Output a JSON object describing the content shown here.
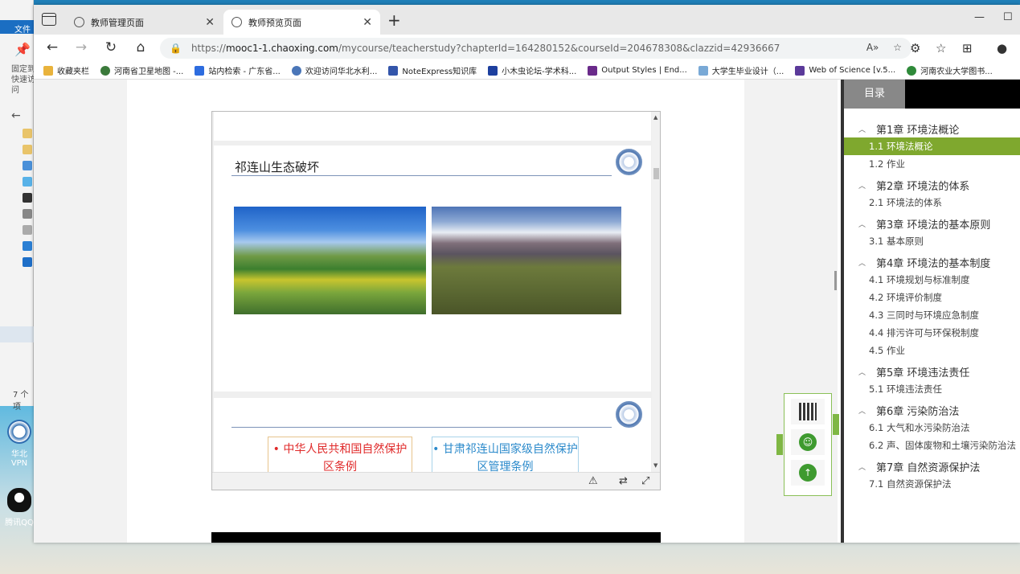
{
  "desktop": {
    "explorer_menu": "文件",
    "pin_label": "固定到快速访问",
    "item_count": "7 个项",
    "icons": [
      {
        "label": "华北VPN",
        "icon": "vpn-icon"
      },
      {
        "label": "腾讯QQ",
        "icon": "qq-penguin-icon"
      }
    ]
  },
  "browser": {
    "tabs": [
      {
        "label": "教师管理页面",
        "active": false
      },
      {
        "label": "教师预览页面",
        "active": true
      }
    ],
    "url_prefix": "https://",
    "url_host": "mooc1-1.chaoxing.com",
    "url_path": "/mycourse/teacherstudy?chapterId=164280152&courseId=204678308&clazzid=42936667",
    "favorites": [
      {
        "label": "收藏夹栏",
        "color": "#e9b33c"
      },
      {
        "label": "河南省卫星地图 -...",
        "color": "#3b7a3b"
      },
      {
        "label": "站内检索 - 广东省...",
        "color": "#2d6cdf"
      },
      {
        "label": "欢迎访问华北水利...",
        "color": "#4a76b8"
      },
      {
        "label": "NoteExpress知识库",
        "color": "#3355aa"
      },
      {
        "label": "小木虫论坛-学术科...",
        "color": "#1d3f9e"
      },
      {
        "label": "Output Styles | End...",
        "color": "#6a2a8a"
      },
      {
        "label": "大学生毕业设计（...",
        "color": "#79a9d6"
      },
      {
        "label": "Web of Science [v.5...",
        "color": "#5b3a9a"
      },
      {
        "label": "河南农业大学图书...",
        "color": "#2f8a3a"
      }
    ]
  },
  "viewer": {
    "slide1_title": "祁连山生态破坏",
    "laws": [
      "• 中华人民共和国自然保护区条例",
      "• 甘肃祁连山国家级自然保护区管理条例"
    ]
  },
  "toc": {
    "tab_label": "目录",
    "chapters": [
      {
        "title": "第1章 环境法概论",
        "sections": [
          "1.1 环境法概论",
          "1.2 作业"
        ]
      },
      {
        "title": "第2章 环境法的体系",
        "sections": [
          "2.1 环境法的体系"
        ]
      },
      {
        "title": "第3章 环境法的基本原则",
        "sections": [
          "3.1 基本原则"
        ]
      },
      {
        "title": "第4章 环境法的基本制度",
        "sections": [
          "4.1 环境规划与标准制度",
          "4.2 环境评价制度",
          "4.3 三同时与环境应急制度",
          "4.4 排污许可与环保税制度",
          "4.5 作业"
        ]
      },
      {
        "title": "第5章 环境违法责任",
        "sections": [
          "5.1 环境违法责任"
        ]
      },
      {
        "title": "第6章 污染防治法",
        "sections": [
          "6.1 大气和水污染防治法",
          "6.2 声、固体废物和土壤污染防治法"
        ]
      },
      {
        "title": "第7章 自然资源保护法",
        "sections": [
          "7.1 自然资源保护法"
        ]
      }
    ],
    "active_section": "1.1 环境法概论"
  }
}
